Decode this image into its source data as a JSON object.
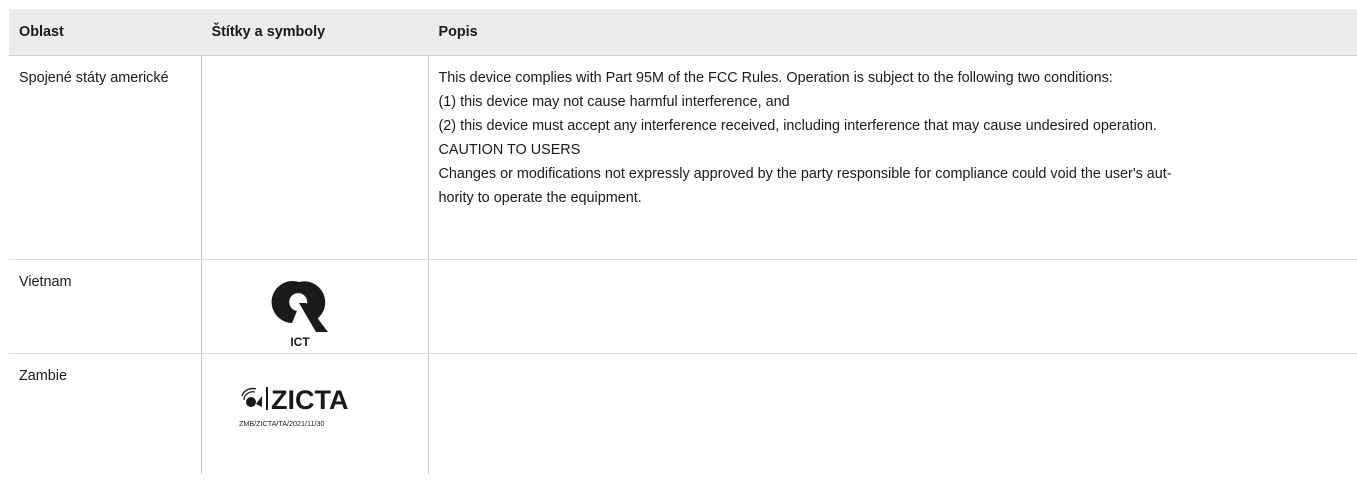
{
  "table": {
    "headers": {
      "region": "Oblast",
      "labels": "Štítky a symboly",
      "description": "Popis"
    },
    "rows": {
      "usa": {
        "region": "Spojené státy americké",
        "description": [
          "This device complies with Part 95M of the FCC Rules. Operation is subject to the following two conditions:",
          "(1) this device may not cause harmful interference, and",
          "(2) this device must accept any interference received, including interference that may cause undesired operation.",
          "CAUTION TO USERS",
          "Changes or modifications not expressly approved by the party responsible for compliance could void the user's aut-",
          "hority to operate the equipment."
        ]
      },
      "vietnam": {
        "region": "Vietnam",
        "symbol_icon": "vietnam-ict-mark-icon",
        "symbol_text": "ICT"
      },
      "zambia": {
        "region": "Zambie",
        "symbol_icon": "zicta-logo-icon",
        "symbol_text": "ZICTA",
        "symbol_code": "ZMB/ZICTA/TA/2021/11/30"
      }
    }
  }
}
